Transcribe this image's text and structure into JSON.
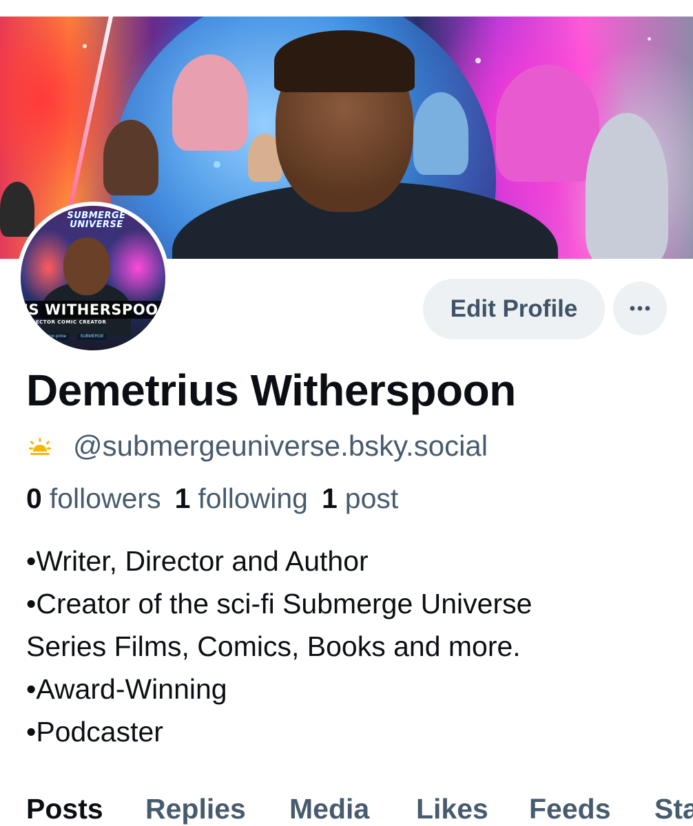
{
  "profile": {
    "display_name": "Demetrius Witherspoon",
    "handle": "@submergeuniverse.bsky.social",
    "avatar_logo_text": "SUBMERGE UNIVERSE",
    "avatar_name_text": "US WITHERSPOO",
    "avatar_sub_text": "RECTOR   COMIC CREATOR",
    "avatar_badges": [
      "amazon prime",
      "SUBMERGE"
    ]
  },
  "actions": {
    "edit_label": "Edit Profile",
    "more_icon": "ellipsis-icon"
  },
  "stats": {
    "followers_count": "0",
    "followers_label": "followers",
    "following_count": "1",
    "following_label": "following",
    "posts_count": "1",
    "posts_label": "post"
  },
  "bio": [
    "•Writer, Director and Author",
    "•Creator of the sci-fi Submerge Universe",
    "Series Films, Comics, Books and more.",
    "•Award-Winning",
    "•Podcaster"
  ],
  "tabs": [
    {
      "label": "Posts",
      "active": true
    },
    {
      "label": "Replies",
      "active": false
    },
    {
      "label": "Media",
      "active": false
    },
    {
      "label": "Likes",
      "active": false
    },
    {
      "label": "Feeds",
      "active": false
    },
    {
      "label": "Starter Packs",
      "active": false
    }
  ],
  "colors": {
    "accent_text": "#475b6e",
    "primary_text": "#0b0f14",
    "button_bg": "#eef1f4",
    "sun_icon": "#f5b700"
  },
  "icons": {
    "handle_icon": "sun-icon"
  }
}
